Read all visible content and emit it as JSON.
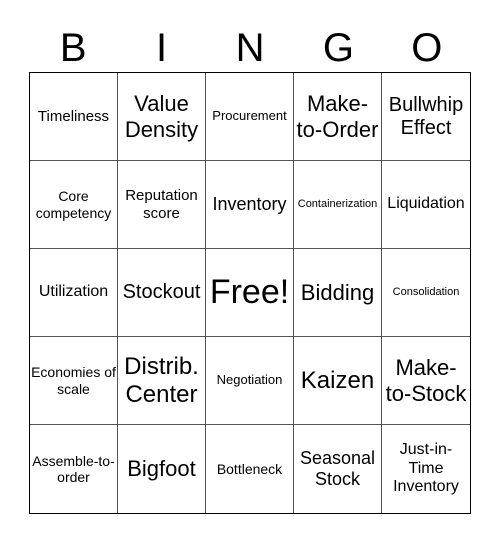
{
  "header": [
    "B",
    "I",
    "N",
    "G",
    "O"
  ],
  "cells": [
    "Timeliness",
    "Value Density",
    "Procurement",
    "Make-to-Order",
    "Bullwhip Effect",
    "Core competency",
    "Reputation score",
    "Inventory",
    "Containerization",
    "Liquidation",
    "Utilization",
    "Stockout",
    "Free!",
    "Bidding",
    "Consolidation",
    "Economies of scale",
    "Distrib. Center",
    "Negotiation",
    "Kaizen",
    "Make-to-Stock",
    "Assemble-to-order",
    "Bigfoot",
    "Bottleneck",
    "Seasonal Stock",
    "Just-in-Time Inventory"
  ]
}
